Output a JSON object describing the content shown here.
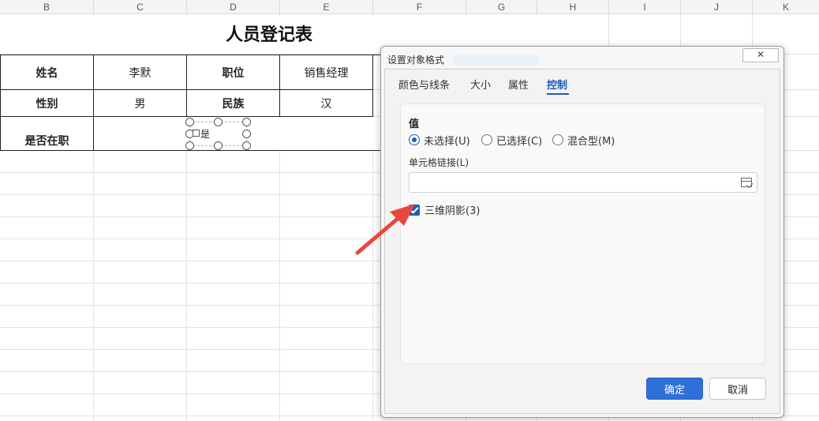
{
  "spreadsheet": {
    "columns": [
      "B",
      "C",
      "D",
      "E",
      "F",
      "G",
      "H",
      "I",
      "J",
      "K"
    ],
    "title": "人员登记表",
    "rows": [
      {
        "label1": "姓名",
        "value1": "李默",
        "label2": "职位",
        "value2": "销售经理"
      },
      {
        "label1": "性别",
        "value1": "男",
        "label2": "民族",
        "value2": "汉"
      }
    ],
    "row3_label": "是否在职",
    "form_checkbox_label": "是"
  },
  "dialog": {
    "title": "设置对象格式",
    "close": "✕",
    "tabs": [
      {
        "label": "颜色与线条"
      },
      {
        "label": "大小"
      },
      {
        "label": "属性"
      },
      {
        "label": "控制"
      }
    ],
    "active_tab": "控制",
    "value_label": "值",
    "radios": [
      {
        "label": "未选择(U)",
        "selected": true
      },
      {
        "label": "已选择(C)",
        "selected": false
      },
      {
        "label": "混合型(M)",
        "selected": false
      }
    ],
    "cell_link_label": "单元格链接(L)",
    "cell_link_value": "",
    "shading_label": "三维阴影(3)",
    "shading_checked": true,
    "ok_label": "确定",
    "cancel_label": "取消"
  },
  "colors": {
    "accent": "#1e5bb8",
    "ok_button": "#2f6fd8",
    "annotation_arrow": "#e8483c"
  }
}
